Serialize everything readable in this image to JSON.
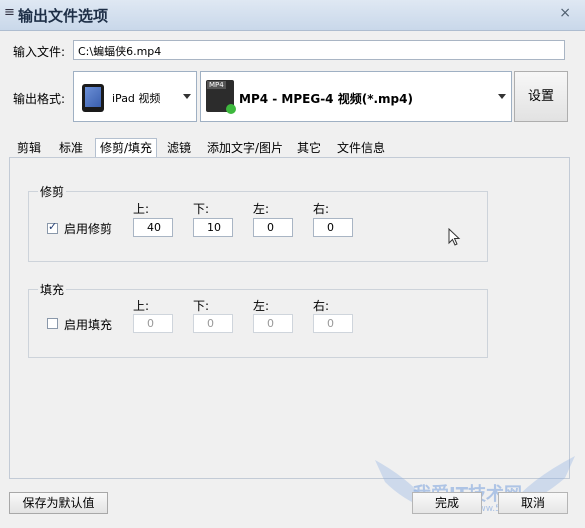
{
  "window": {
    "title": "输出文件选项",
    "system_icon": "≡",
    "close_symbol": "×"
  },
  "input": {
    "label": "输入文件:",
    "value": "C:\\蝙蝠侠6.mp4"
  },
  "output": {
    "label": "输出格式:",
    "device": "iPad 视频",
    "format": "MP4 - MPEG-4 视频(*.mp4)",
    "settings_label": "设置"
  },
  "tabs": [
    "剪辑",
    "标准",
    "修剪/填充",
    "滤镜",
    "添加文字/图片",
    "其它",
    "文件信息"
  ],
  "active_tab": "修剪/填充",
  "crop": {
    "title": "修剪",
    "enable_label": "启用修剪",
    "enabled": true,
    "labels": [
      "上:",
      "下:",
      "左:",
      "右:"
    ],
    "values": [
      "40",
      "10",
      "0",
      "0"
    ]
  },
  "pad": {
    "title": "填充",
    "enable_label": "启用填充",
    "enabled": false,
    "labels": [
      "上:",
      "下:",
      "左:",
      "右:"
    ],
    "values": [
      "0",
      "0",
      "0",
      "0"
    ]
  },
  "footer": {
    "save_default": "保存为默认值",
    "ok": "完成",
    "cancel": "取消"
  },
  "watermark": {
    "text": "我爱IT技术网",
    "url": "www.52ij.com"
  }
}
